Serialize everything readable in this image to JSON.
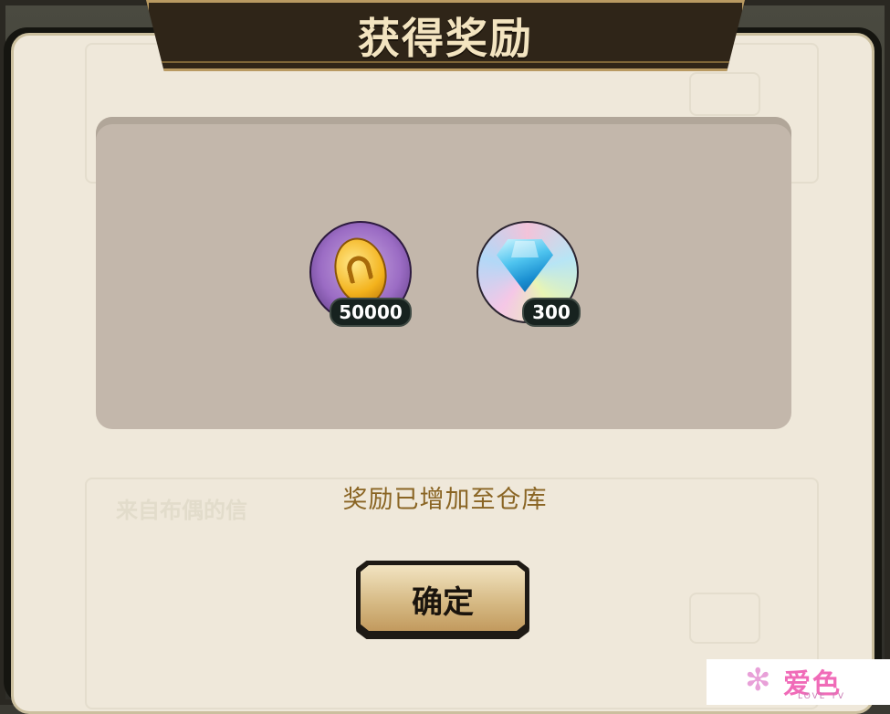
{
  "dialog": {
    "title": "获得奖励",
    "message": "奖励已增加至仓库",
    "confirm_label": "确定"
  },
  "rewards": [
    {
      "name": "gold-coin",
      "count": "50000"
    },
    {
      "name": "diamond",
      "count": "300"
    }
  ],
  "background": {
    "mail_sender": "来自布偶的信"
  },
  "watermark": {
    "text": "爱色",
    "subtext": "LOVE TV"
  },
  "colors": {
    "title": "#f3e4c0",
    "message": "#8a6524",
    "panel": "#c3b7ab",
    "parchment": "#efe8da"
  }
}
